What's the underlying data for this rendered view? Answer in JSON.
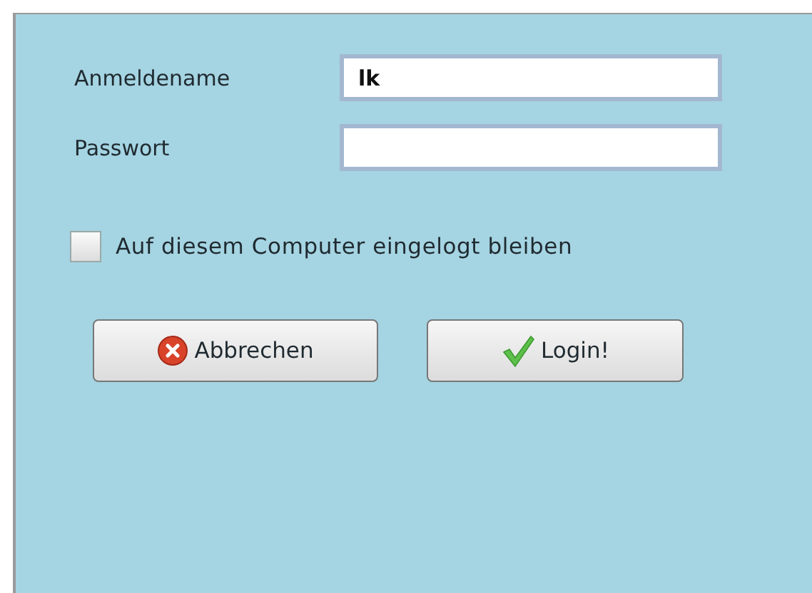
{
  "form": {
    "fields": [
      {
        "label": "Anmeldename",
        "value": "lk"
      },
      {
        "label": "Passwort"
      }
    ],
    "remember": {
      "label": "Auf diesem Computer eingelogt bleiben",
      "checked": false
    },
    "buttons": [
      {
        "kind": "cancel",
        "label": "Abbrechen"
      },
      {
        "kind": "confirm",
        "label": "Login!"
      }
    ]
  }
}
